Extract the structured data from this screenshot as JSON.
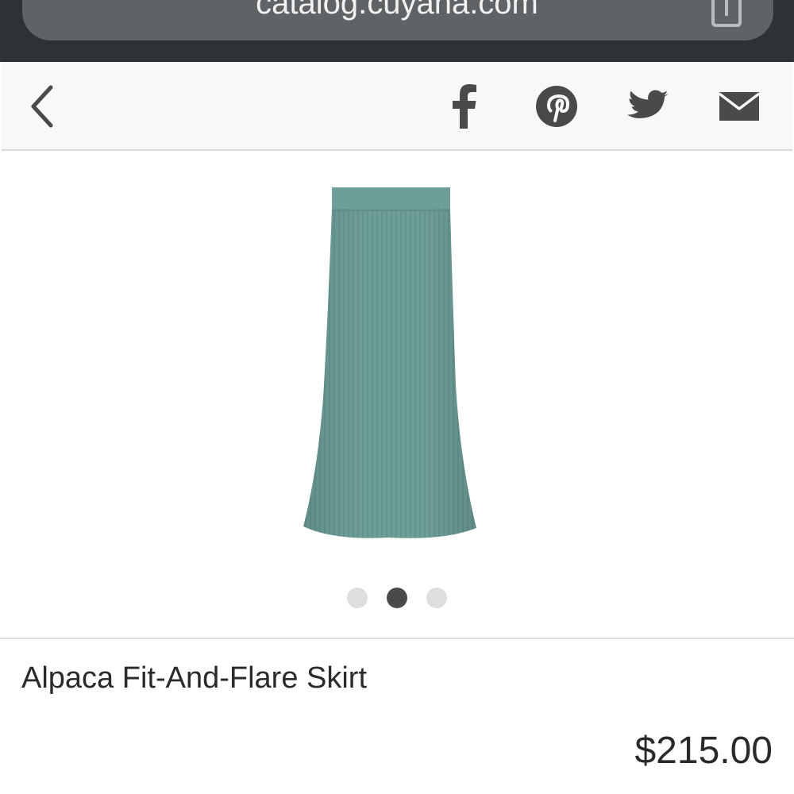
{
  "browser": {
    "url": "catalog.cuyana.com"
  },
  "toolbar": {
    "back_icon": "chevron-left-icon",
    "share_icons": [
      "facebook-icon",
      "pinterest-icon",
      "twitter-icon",
      "mail-icon"
    ]
  },
  "product": {
    "image": "skirt-photo",
    "title": "Alpaca Fit-And-Flare Skirt",
    "price": "$215.00",
    "color": "#6e9e98"
  },
  "carousel": {
    "count": 3,
    "active_index": 1
  },
  "colors": {
    "browser_bar": "#2f3234",
    "url_pill": "#5f6365",
    "icon": "#4a4a4a",
    "text": "#2a2a2a"
  }
}
